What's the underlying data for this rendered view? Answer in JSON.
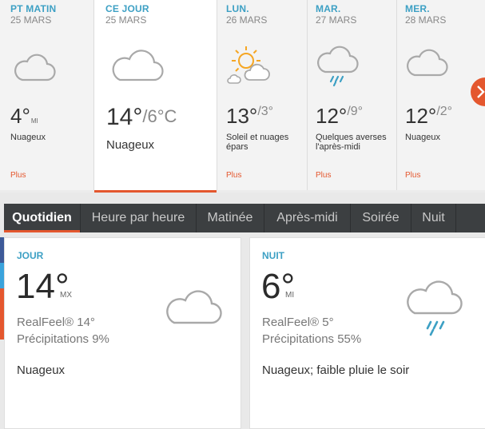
{
  "forecast": [
    {
      "day": "PT MATIN",
      "date": "25 MARS",
      "temp": "4°",
      "low": "",
      "unit": "MI",
      "cond": "Nuageux",
      "more": "Plus",
      "icon": "cloud-icon"
    },
    {
      "day": "CE JOUR",
      "date": "25 MARS",
      "temp": "14°",
      "low": "/6°C",
      "unit": "",
      "cond": "Nuageux",
      "more": "",
      "icon": "cloud-icon"
    },
    {
      "day": "LUN.",
      "date": "26 MARS",
      "temp": "13°",
      "low": "/3°",
      "unit": "",
      "cond": "Soleil et nuages épars",
      "more": "Plus",
      "icon": "sun-cloud-icon"
    },
    {
      "day": "MAR.",
      "date": "27 MARS",
      "temp": "12°",
      "low": "/9°",
      "unit": "",
      "cond": "Quelques averses l'après-midi",
      "more": "Plus",
      "icon": "cloud-rain-icon"
    },
    {
      "day": "MER.",
      "date": "28 MARS",
      "temp": "12°",
      "low": "/2°",
      "unit": "",
      "cond": "Nuageux",
      "more": "Plus",
      "icon": "cloud-icon"
    }
  ],
  "tabs": [
    "Quotidien",
    "Heure par heure",
    "Matinée",
    "Après-midi",
    "Soirée",
    "Nuit"
  ],
  "active_tab": "Quotidien",
  "cards": {
    "jour": {
      "label": "JOUR",
      "temp": "14°",
      "unit": "MX",
      "realfeel": "RealFeel® 14°",
      "precip": "Précipitations 9%",
      "desc": "Nuageux",
      "icon": "cloud-icon"
    },
    "nuit": {
      "label": "NUIT",
      "temp": "6°",
      "unit": "MI",
      "realfeel": "RealFeel® 5°",
      "precip": "Précipitations 55%",
      "desc": "Nuageux; faible pluie le soir",
      "icon": "cloud-rain-icon"
    }
  },
  "colors": {
    "accent": "#e4572e",
    "label_blue": "#3da0c4",
    "tab_bar": "#3c3f41",
    "rain": "#3da0c4",
    "sun": "#f5a623"
  }
}
